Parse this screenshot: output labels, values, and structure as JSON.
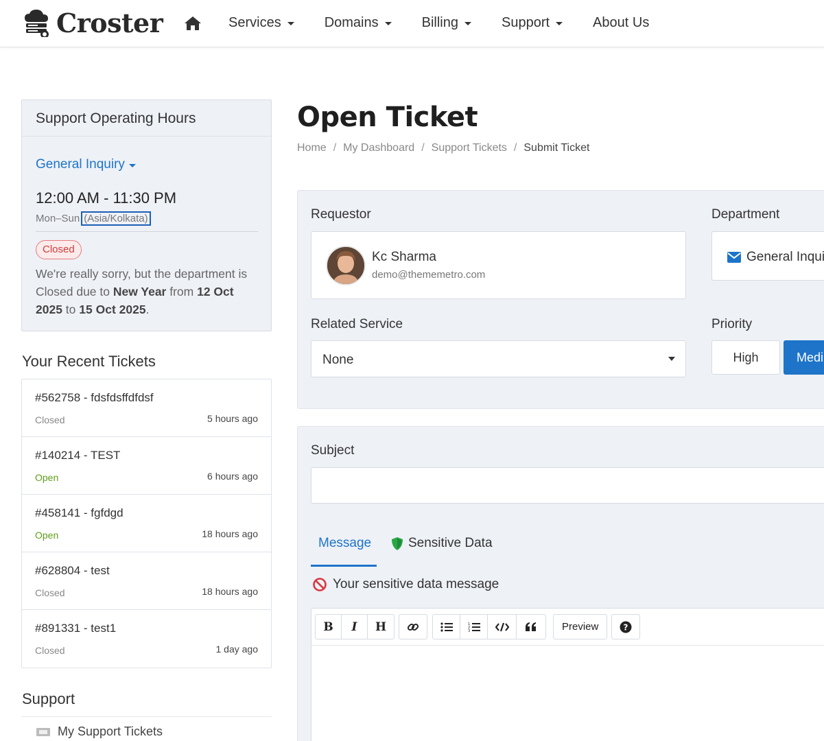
{
  "brand": {
    "name": "Croster"
  },
  "nav": {
    "items": [
      {
        "label": "Services",
        "dropdown": true
      },
      {
        "label": "Domains",
        "dropdown": true
      },
      {
        "label": "Billing",
        "dropdown": true
      },
      {
        "label": "Support",
        "dropdown": true
      },
      {
        "label": "About Us",
        "dropdown": false
      }
    ]
  },
  "hours": {
    "title": "Support Operating Hours",
    "department": "General Inquiry",
    "time": "12:00 AM - 11:30 PM",
    "days": "Mon–Sun",
    "timezone": "(Asia/Kolkata)",
    "status": "Closed",
    "message_pre": "We're really sorry, but the department is Closed due to ",
    "holiday": "New Year",
    "from_word": " from ",
    "from_date": "12 Oct 2025",
    "to_word": " to ",
    "to_date": "15 Oct 2025",
    "end": "."
  },
  "recent": {
    "title": "Your Recent Tickets",
    "tickets": [
      {
        "title": "#562758 - fdsfdsffdfdsf",
        "status": "Closed",
        "time": "5 hours ago"
      },
      {
        "title": "#140214 - TEST",
        "status": "Open",
        "time": "6 hours ago"
      },
      {
        "title": "#458141 - fgfdgd",
        "status": "Open",
        "time": "18 hours ago"
      },
      {
        "title": "#628804 - test",
        "status": "Closed",
        "time": "18 hours ago"
      },
      {
        "title": "#891331 - test1",
        "status": "Closed",
        "time": "1 day ago"
      }
    ]
  },
  "support": {
    "title": "Support",
    "items": [
      {
        "label": "My Support Tickets"
      }
    ]
  },
  "page": {
    "title": "Open Ticket",
    "breadcrumb": [
      "Home",
      "My Dashboard",
      "Support Tickets",
      "Submit Ticket"
    ]
  },
  "form": {
    "requestor_label": "Requestor",
    "requestor_name": "Kc Sharma",
    "requestor_email": "demo@thememetro.com",
    "department_label": "Department",
    "department_value": "General Inquiry",
    "related_label": "Related Service",
    "related_value": "None",
    "priority_label": "Priority",
    "priority_options": [
      "High",
      "Medium"
    ],
    "priority_selected": "Medium",
    "subject_label": "Subject",
    "subject_value": "",
    "tabs": [
      "Message",
      "Sensitive Data"
    ],
    "active_tab": "Message",
    "sensitive_message": "Your sensitive data message",
    "toolbar_preview": "Preview"
  },
  "colors": {
    "accent": "#1d74c9",
    "closed": "#d23a3a",
    "open": "#5f9d1a",
    "panel": "#eef1f6"
  }
}
